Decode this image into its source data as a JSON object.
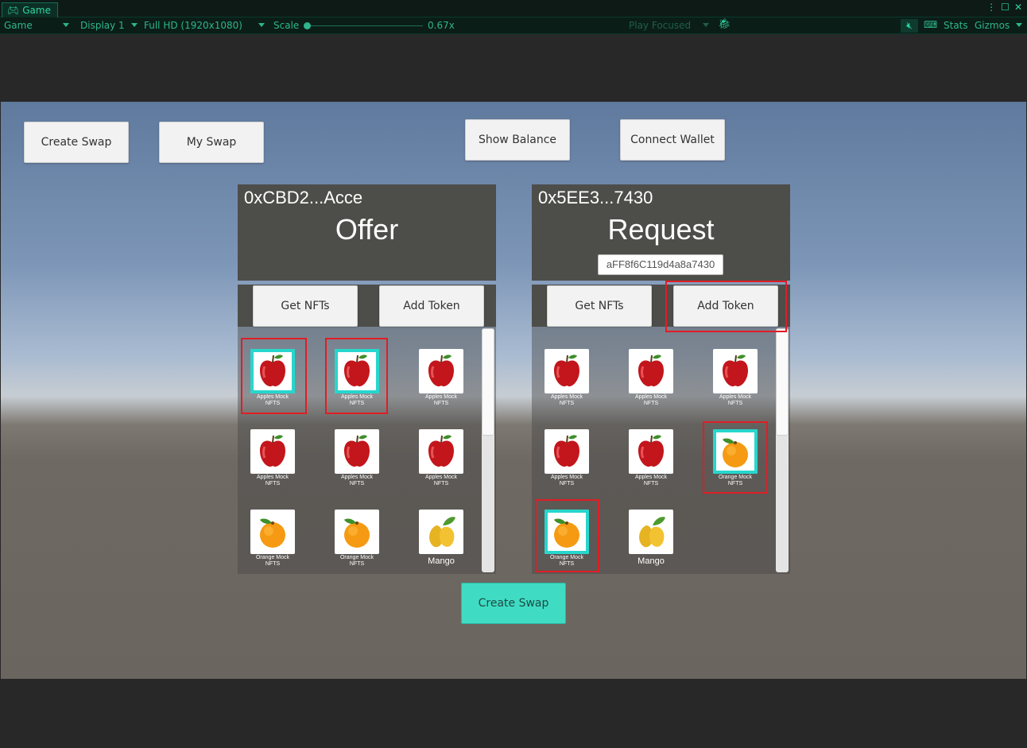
{
  "window": {
    "tab_title": "Game",
    "controller_icon": "gamepad-icon"
  },
  "toolbar": {
    "view_mode": "Game",
    "display": "Display 1",
    "resolution": "Full HD (1920x1080)",
    "scale_label": "Scale",
    "scale_value": "0.67x",
    "play_mode": "Play Focused",
    "stats": "Stats",
    "gizmos": "Gizmos"
  },
  "top_buttons": {
    "create_swap": "Create Swap",
    "my_swap": "My Swap",
    "show_balance": "Show Balance",
    "connect_wallet": "Connect Wallet"
  },
  "offer": {
    "address": "0xCBD2...Acce",
    "title": "Offer",
    "get_nfts": "Get NFTs",
    "add_token": "Add Token",
    "items": [
      {
        "label": "Apples Mock NFTS",
        "fruit": "apple",
        "selected": true
      },
      {
        "label": "Apples Mock NFTS",
        "fruit": "apple",
        "selected": true
      },
      {
        "label": "Apples Mock NFTS",
        "fruit": "apple",
        "selected": false
      },
      {
        "label": "Apples Mock NFTS",
        "fruit": "apple",
        "selected": false
      },
      {
        "label": "Apples Mock NFTS",
        "fruit": "apple",
        "selected": false
      },
      {
        "label": "Apples Mock NFTS",
        "fruit": "apple",
        "selected": false
      },
      {
        "label": "Orange Mock NFTS",
        "fruit": "orange",
        "selected": false
      },
      {
        "label": "Orange Mock NFTS",
        "fruit": "orange",
        "selected": false
      },
      {
        "label": "Mango",
        "fruit": "mango",
        "selected": false
      }
    ]
  },
  "request": {
    "address": "0x5EE3...7430",
    "title": "Request",
    "token_input": "aFF8f6C119d4a8a7430",
    "get_nfts": "Get NFTs",
    "add_token": "Add Token",
    "items": [
      {
        "label": "Apples Mock NFTS",
        "fruit": "apple",
        "selected": false
      },
      {
        "label": "Apples Mock NFTS",
        "fruit": "apple",
        "selected": false
      },
      {
        "label": "Apples Mock NFTS",
        "fruit": "apple",
        "selected": false
      },
      {
        "label": "Apples Mock NFTS",
        "fruit": "apple",
        "selected": false
      },
      {
        "label": "Apples Mock NFTS",
        "fruit": "apple",
        "selected": false
      },
      {
        "label": "Orange Mock NFTS",
        "fruit": "orange",
        "selected": true
      },
      {
        "label": "Orange Mock NFTS",
        "fruit": "orange",
        "selected": true
      },
      {
        "label": "Mango",
        "fruit": "mango",
        "selected": false
      }
    ]
  },
  "bottom": {
    "create_swap": "Create Swap"
  },
  "colors": {
    "selection": "#27d6cc",
    "highlight": "#e11d25",
    "accent_button": "#3fdcc3",
    "panel": "#4d4d4a"
  }
}
